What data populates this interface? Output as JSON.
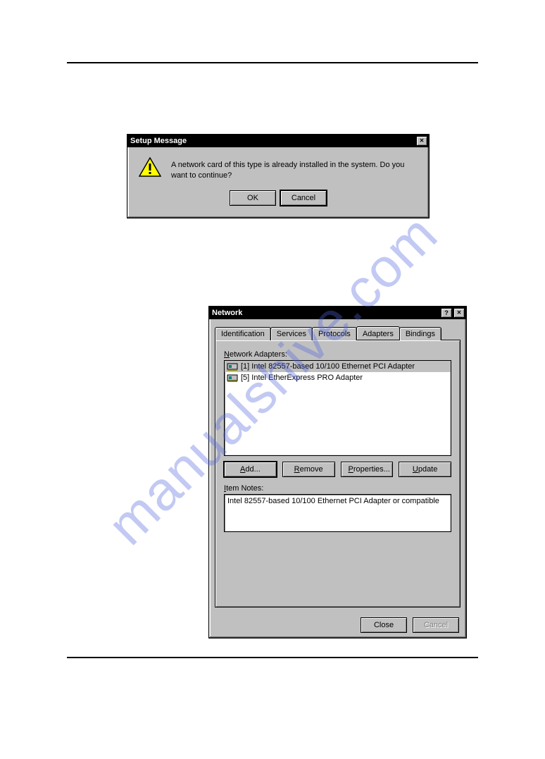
{
  "watermark": "manualshive.com",
  "setup_message": {
    "title": "Setup Message",
    "body": "A network card of this type is already installed in the system. Do you want to continue?",
    "ok_label": "OK",
    "cancel_label": "Cancel"
  },
  "network_dialog": {
    "title": "Network",
    "tabs": {
      "identification": "Identification",
      "services": "Services",
      "protocols": "Protocols",
      "adapters": "Adapters",
      "bindings": "Bindings"
    },
    "active_tab": "adapters",
    "adapters_label_prefix": "N",
    "adapters_label_rest": "etwork Adapters:",
    "adapters": [
      {
        "label": "[1] Intel 82557-based 10/100 Ethernet PCI Adapter",
        "selected": true
      },
      {
        "label": "[5] Intel EtherExpress PRO Adapter",
        "selected": false
      }
    ],
    "buttons": {
      "add": "Add...",
      "remove": "Remove",
      "properties": "Properties...",
      "update": "Update"
    },
    "button_underline": {
      "add": "A",
      "remove": "R",
      "properties": "P",
      "update": "U"
    },
    "item_notes_label_prefix": "I",
    "item_notes_label_rest": "tem Notes:",
    "item_notes": "Intel 82557-based 10/100 Ethernet PCI Adapter or compatible",
    "close_label": "Close",
    "cancel_label": "Cancel"
  }
}
